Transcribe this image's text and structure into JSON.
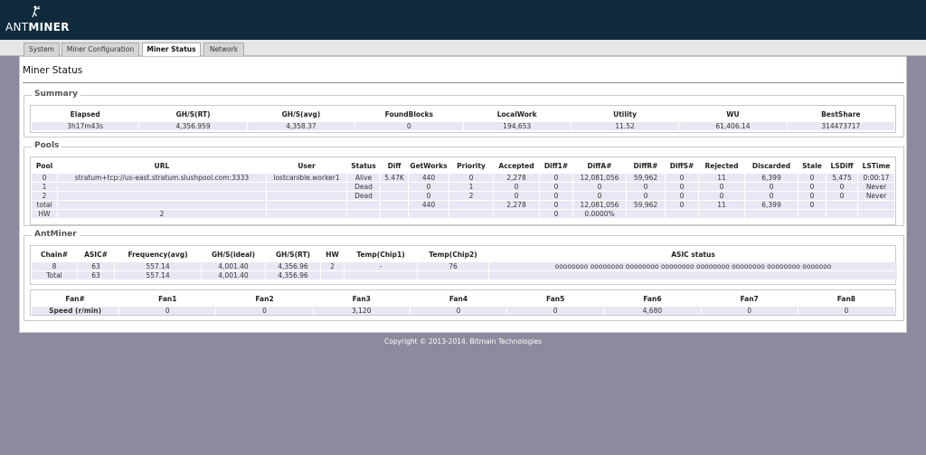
{
  "brand": {
    "ant": "ANT",
    "miner": "MINER"
  },
  "tabs": [
    {
      "label": "System"
    },
    {
      "label": "Miner Configuration"
    },
    {
      "label": "Miner Status"
    },
    {
      "label": "Network"
    }
  ],
  "page_title": "Miner Status",
  "summary": {
    "legend": "Summary",
    "headers": [
      "Elapsed",
      "GH/S(RT)",
      "GH/S(avg)",
      "FoundBlocks",
      "LocalWork",
      "Utility",
      "WU",
      "BestShare"
    ],
    "row": [
      "3h17m43s",
      "4,356.959",
      "4,358.37",
      "0",
      "194,653",
      "11.52",
      "61,406.14",
      "314473717"
    ]
  },
  "pools": {
    "legend": "Pools",
    "headers": [
      "Pool",
      "URL",
      "User",
      "Status",
      "Diff",
      "GetWorks",
      "Priority",
      "Accepted",
      "Diff1#",
      "DiffA#",
      "DiffR#",
      "DiffS#",
      "Rejected",
      "Discarded",
      "Stale",
      "LSDiff",
      "LSTime"
    ],
    "rows": [
      [
        "0",
        "stratum+tcp://us-east.stratum.slushpool.com:3333",
        "lostcanible.worker1",
        "Alive",
        "5.47K",
        "440",
        "0",
        "2,278",
        "0",
        "12,081,056",
        "59,962",
        "0",
        "11",
        "6,399",
        "0",
        "5,475",
        "0:00:17"
      ],
      [
        "1",
        "",
        "",
        "Dead",
        "",
        "0",
        "1",
        "0",
        "0",
        "0",
        "0",
        "0",
        "0",
        "0",
        "0",
        "0",
        "Never"
      ],
      [
        "2",
        "",
        "",
        "Dead",
        "",
        "0",
        "2",
        "0",
        "0",
        "0",
        "0",
        "0",
        "0",
        "0",
        "0",
        "0",
        "Never"
      ],
      [
        "total",
        "",
        "",
        "",
        "",
        "440",
        "",
        "2,278",
        "0",
        "12,081,056",
        "59,962",
        "0",
        "11",
        "6,399",
        "0",
        "",
        ""
      ],
      [
        "HW",
        "2",
        "",
        "",
        "",
        "",
        "",
        "",
        "0",
        "0.0000%",
        "",
        "",
        "",
        "",
        "",
        "",
        ""
      ]
    ]
  },
  "antminer": {
    "legend": "AntMiner",
    "chain_headers": [
      "Chain#",
      "ASIC#",
      "Frequency(avg)",
      "GH/S(ideal)",
      "GH/S(RT)",
      "HW",
      "Temp(Chip1)",
      "Temp(Chip2)",
      "ASIC status"
    ],
    "chain_rows": [
      [
        "8",
        "63",
        "557.14",
        "4,001.40",
        "4,356.96",
        "2",
        "-",
        "76",
        "oooooooo oooooooo oooooooo oooooooo oooooooo oooooooo oooooooo ooooooo"
      ],
      [
        "Total",
        "63",
        "557.14",
        "4,001.40",
        "4,356.96",
        "",
        "",
        "",
        ""
      ]
    ],
    "fan_headers": [
      "Fan#",
      "Fan1",
      "Fan2",
      "Fan3",
      "Fan4",
      "Fan5",
      "Fan6",
      "Fan7",
      "Fan8"
    ],
    "fan_row": [
      "Speed (r/min)",
      "0",
      "0",
      "3,120",
      "0",
      "0",
      "4,680",
      "0",
      "0"
    ]
  },
  "footer": "Copyright © 2013-2014, Bitmain Technologies"
}
